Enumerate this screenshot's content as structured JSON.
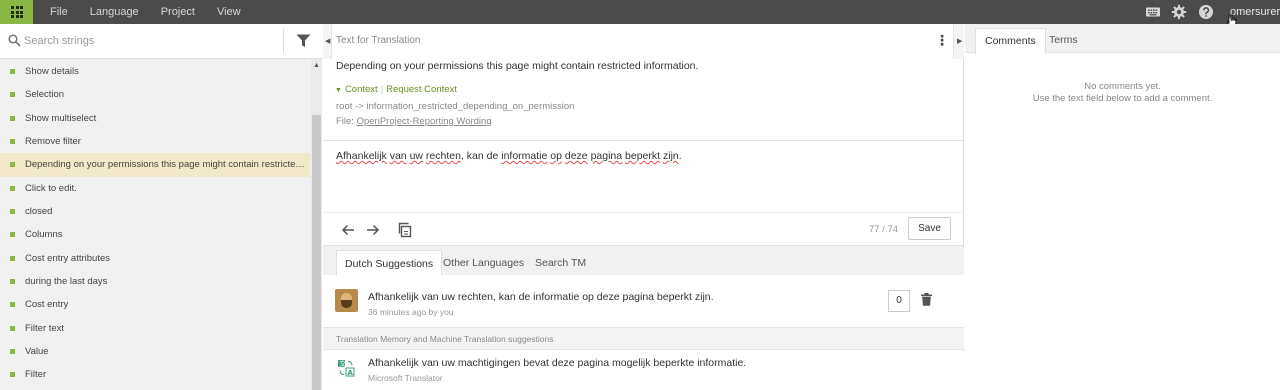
{
  "topbar": {
    "menu": [
      "File",
      "Language",
      "Project",
      "View"
    ],
    "username": "omersurer",
    "tooltip": "omersurer",
    "accent_color": "#8bb845",
    "icons": [
      "apps-grid-icon",
      "keyboard-icon",
      "gear-icon",
      "help-icon"
    ]
  },
  "left": {
    "search_placeholder": "Search strings",
    "items": [
      "Show details",
      "Selection",
      "Show multiselect",
      "Remove filter",
      "Depending on your permissions this page might contain restricted information.",
      "Click to edit.",
      "closed",
      "Columns",
      "Cost entry attributes",
      "during the last days",
      "Cost entry",
      "Filter text",
      "Value",
      "Filter"
    ],
    "active_index": 4
  },
  "source": {
    "title": "Text for Translation",
    "text": "Depending on your permissions this page might contain restricted information.",
    "context_label": "Context",
    "request_context_label": "Request Context",
    "key": "root -> information_restricted_depending_on_permission",
    "file_prefix": "File:",
    "file_name": "OpenProject-Reporting Wording"
  },
  "translation": {
    "words": [
      {
        "t": "Afhankelijk",
        "spell": true
      },
      {
        "t": " ",
        "spell": false
      },
      {
        "t": "van",
        "spell": true
      },
      {
        "t": " ",
        "spell": false
      },
      {
        "t": "uw",
        "spell": true
      },
      {
        "t": " ",
        "spell": false
      },
      {
        "t": "rechten",
        "spell": true
      },
      {
        "t": ", kan de ",
        "spell": false
      },
      {
        "t": "informatie",
        "spell": true
      },
      {
        "t": " ",
        "spell": false
      },
      {
        "t": "op",
        "spell": true
      },
      {
        "t": " ",
        "spell": false
      },
      {
        "t": "deze",
        "spell": true
      },
      {
        "t": " ",
        "spell": false
      },
      {
        "t": "pagina",
        "spell": true
      },
      {
        "t": " ",
        "spell": false
      },
      {
        "t": "beperkt",
        "spell": true
      },
      {
        "t": " ",
        "spell": false
      },
      {
        "t": "zijn",
        "spell": true
      },
      {
        "t": ".",
        "spell": false
      }
    ],
    "counter": "77 / 74",
    "save_label": "Save"
  },
  "suggestions": {
    "tabs": [
      "Dutch Suggestions",
      "Other Languages",
      "Search TM"
    ],
    "active_tab": 0,
    "own": {
      "text": "Afhankelijk van uw rechten, kan de informatie op deze pagina beperkt zijn.",
      "meta": "36 minutes ago by you",
      "votes": "0"
    },
    "tm_header": "Translation Memory and Machine Translation suggestions",
    "mt": {
      "text": "Afhankelijk van uw machtigingen bevat deze pagina mogelijk beperkte informatie.",
      "meta": "Microsoft Translator"
    }
  },
  "right": {
    "tabs": [
      "Comments",
      "Terms"
    ],
    "active_tab": 0,
    "empty_line1": "No comments yet.",
    "empty_line2": "Use the text field below to add a comment."
  }
}
